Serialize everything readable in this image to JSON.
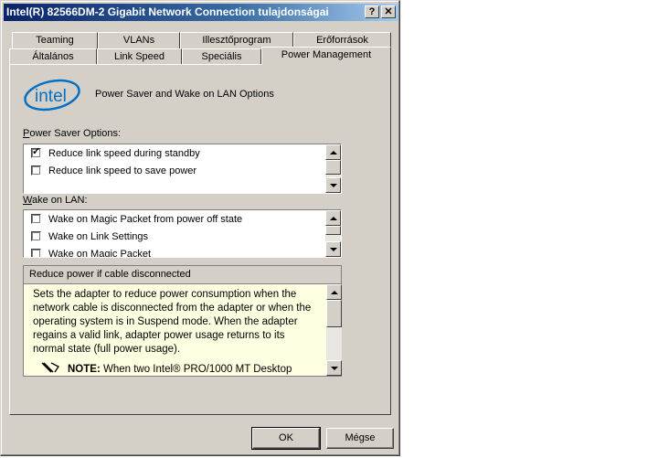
{
  "window": {
    "title": "Intel(R) 82566DM-2 Gigabit Network Connection tulajdonságai",
    "help_glyph": "?",
    "close_glyph": "✕"
  },
  "tabs": {
    "row1": [
      "Teaming",
      "VLANs",
      "Illesztőprogram",
      "Erőforrások"
    ],
    "row2": [
      "Általános",
      "Link Speed",
      "Speciális",
      "Power Management"
    ],
    "active": "Power Management"
  },
  "header": {
    "logo_text": "intel",
    "title": "Power Saver and Wake on LAN Options"
  },
  "power_saver": {
    "label_u": "P",
    "label_rest": "ower Saver Options:",
    "items": [
      {
        "label": "Reduce link speed during standby",
        "checked": true
      },
      {
        "label": "Reduce link speed to save power",
        "checked": false
      }
    ]
  },
  "wake_on_lan": {
    "label_u": "W",
    "label_rest": "ake on LAN:",
    "items": [
      {
        "label": "Wake on Magic Packet from power off state",
        "checked": false
      },
      {
        "label": "Wake on Link Settings",
        "checked": false
      },
      {
        "label": "Wake on Magic Packet",
        "checked": false
      }
    ]
  },
  "description": {
    "header": "Reduce power if cable disconnected",
    "text": "Sets the adapter to reduce power consumption when the network cable is disconnected from the adapter or when the operating system is in Suspend mode. When the adapter regains a valid link, adapter power usage returns to its normal state (full power usage).",
    "note_label": "NOTE:",
    "note_text": "When two Intel® PRO/1000 MT Desktop"
  },
  "buttons": {
    "ok": "OK",
    "cancel": "Mégse"
  },
  "colors": {
    "titlebar_start": "#0a246a",
    "titlebar_end": "#a6caf0",
    "face": "#d4d0c8",
    "description_bg": "#ffffe1",
    "intel_blue": "#0071c5"
  }
}
